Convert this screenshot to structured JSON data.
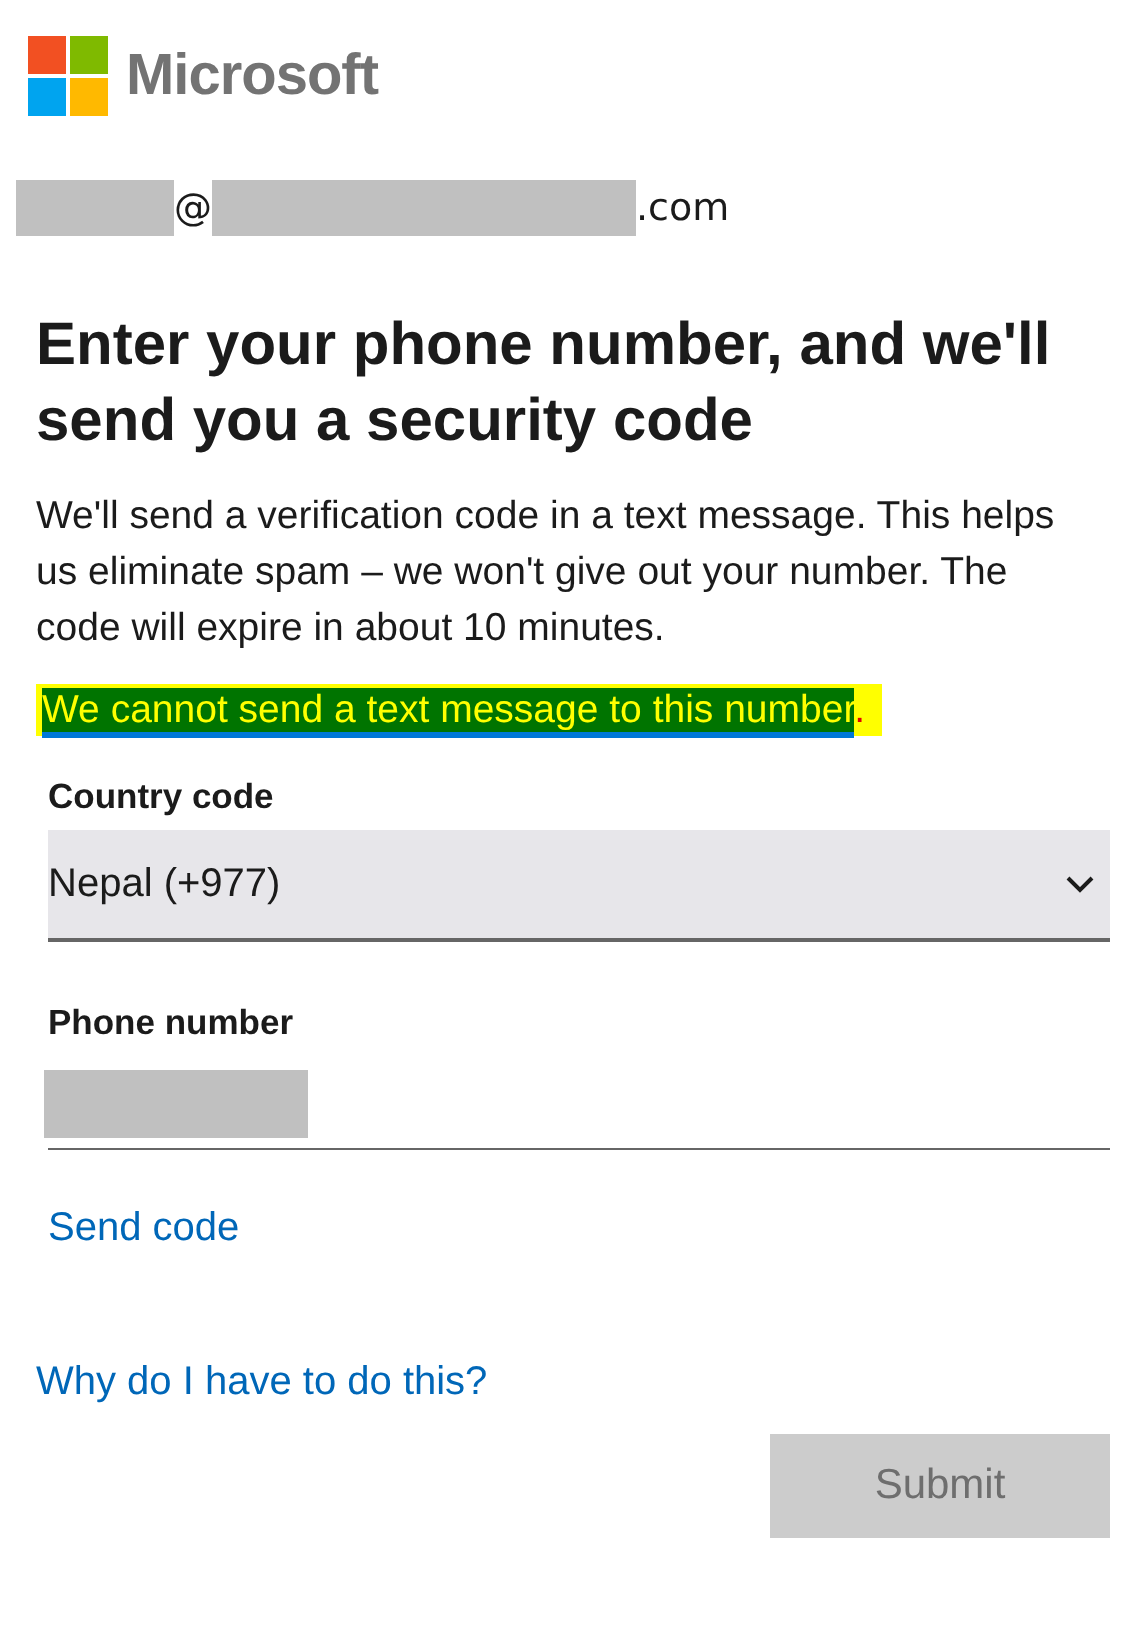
{
  "brand": {
    "name": "Microsoft"
  },
  "account": {
    "at": "@",
    "domain_suffix": ".com"
  },
  "heading": "Enter your phone number, and we'll send you a security code",
  "description": "We'll send a verification code in a text message. This helps us eliminate spam – we won't give out your number. The code will expire in about 10 minutes.",
  "error": {
    "message": "We cannot send a text message to this number."
  },
  "country_code": {
    "label": "Country code",
    "value": "Nepal (+977)"
  },
  "phone_number": {
    "label": "Phone number"
  },
  "send_code": "Send code",
  "why_link": "Why do I have to do this?",
  "submit": {
    "label": "Submit",
    "disabled": true
  }
}
